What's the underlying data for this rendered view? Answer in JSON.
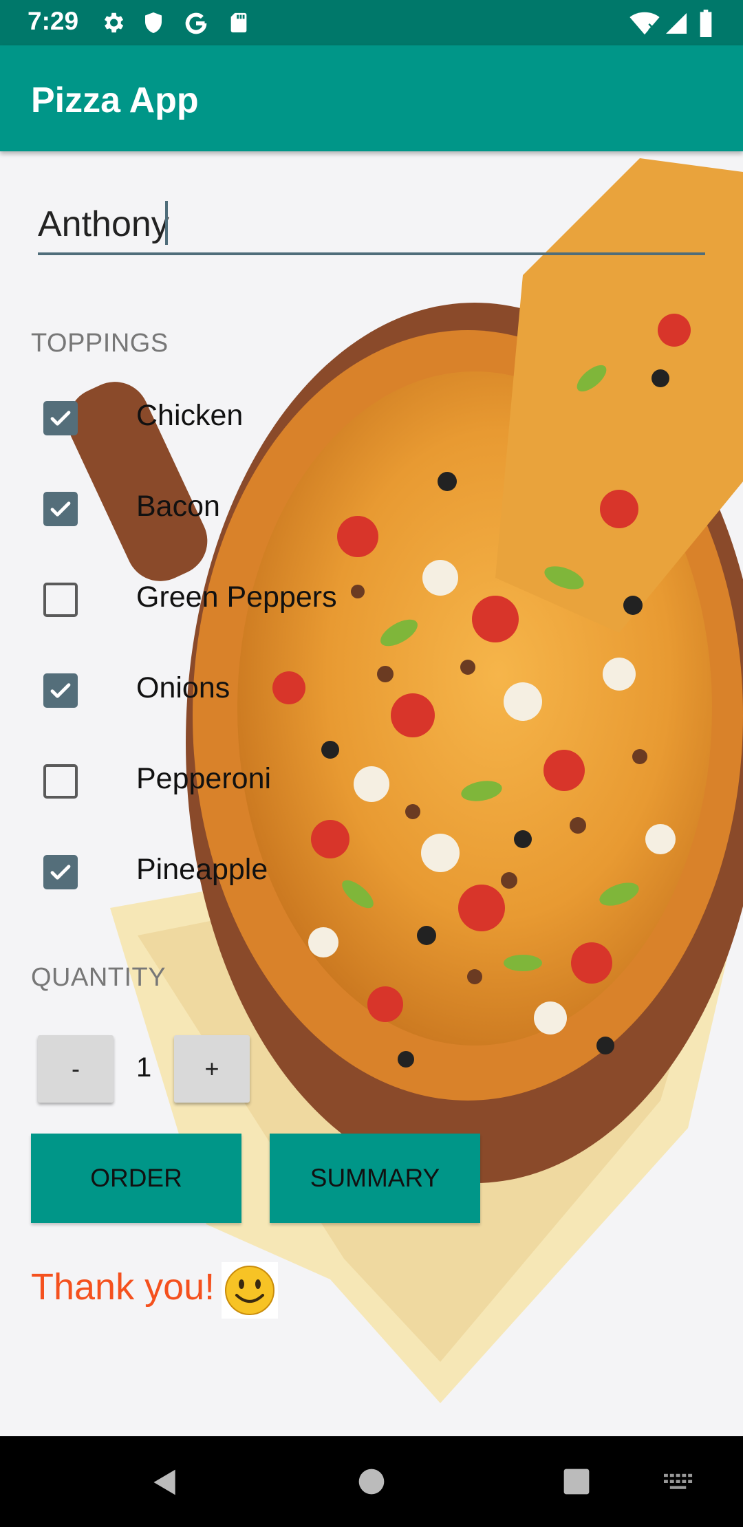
{
  "status_bar": {
    "time": "7:29",
    "icons_left": [
      "gear-icon",
      "shield-icon",
      "google-g-icon",
      "sd-card-icon"
    ],
    "icons_right": [
      "wifi-icon",
      "signal-icon",
      "battery-icon"
    ]
  },
  "app_bar": {
    "title": "Pizza App"
  },
  "name_field": {
    "value": "Anthony"
  },
  "toppings": {
    "header": "TOPPINGS",
    "items": [
      {
        "label": "Chicken",
        "checked": true
      },
      {
        "label": "Bacon",
        "checked": true
      },
      {
        "label": "Green Peppers",
        "checked": false
      },
      {
        "label": "Onions",
        "checked": true
      },
      {
        "label": "Pepperoni",
        "checked": false
      },
      {
        "label": "Pineapple",
        "checked": true
      }
    ]
  },
  "quantity": {
    "header": "QUANTITY",
    "decrement_label": "-",
    "value": "1",
    "increment_label": "+"
  },
  "actions": {
    "order_label": "ORDER",
    "summary_label": "SUMMARY"
  },
  "message": {
    "text": "Thank you!",
    "emoji_icon": "smiley-face-icon"
  },
  "colors": {
    "primary": "#009688",
    "primary_dark": "#00786a",
    "checkbox": "#546e7a",
    "accent_text": "#f4511e"
  },
  "nav_bar": {
    "icons": [
      "back-icon",
      "home-icon",
      "recents-icon",
      "keyboard-icon"
    ]
  }
}
